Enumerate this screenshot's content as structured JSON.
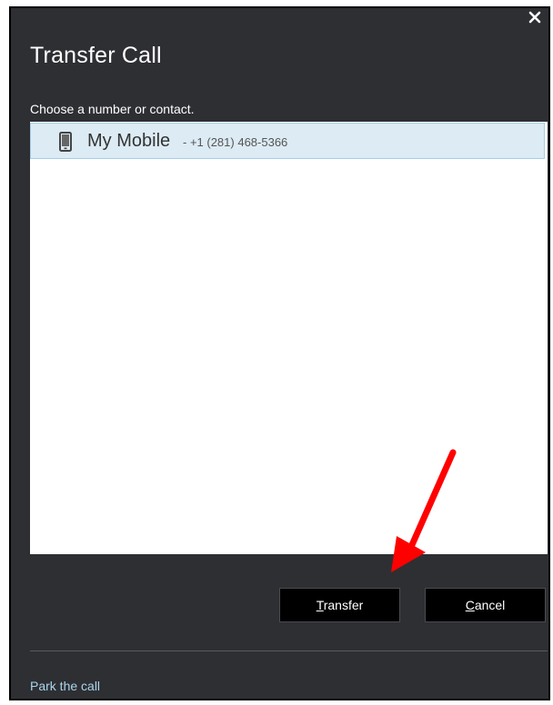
{
  "dialog": {
    "title": "Transfer Call",
    "prompt": "Choose a number or contact.",
    "close_icon": "close-icon"
  },
  "contacts": [
    {
      "icon": "mobile-phone-icon",
      "name": "My Mobile",
      "number": "- +1 (281) 468-5366",
      "selected": true
    }
  ],
  "buttons": {
    "transfer": {
      "accesskey": "T",
      "rest": "ransfer"
    },
    "cancel": {
      "accesskey": "C",
      "rest": "ancel"
    }
  },
  "footer": {
    "park_link": "Park the call"
  },
  "annotation": {
    "icon": "red-arrow-icon",
    "color": "#ff0000"
  },
  "colors": {
    "dialog_background": "#2e2f33",
    "selected_row": "#dcebf4",
    "link": "#a9d4ec"
  }
}
